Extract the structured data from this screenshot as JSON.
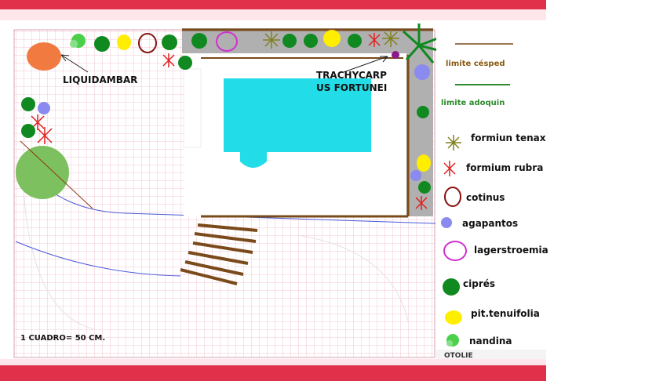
{
  "labels": {
    "liquidambar": "LIQUIDAMBAR",
    "trachycarpus_line1": "TRACHYCARP",
    "trachycarpus_line2": "US FORTUNEI",
    "scale": "1 CUADRO= 50 CM.",
    "bottom_fragment": "OTOLIE"
  },
  "legend": [
    {
      "key": "limite-cesped",
      "label": "limite césped",
      "color": "#7a4a1a"
    },
    {
      "key": "limite-adoquin",
      "label": "limite adoquin",
      "color": "#2d8a2d"
    },
    {
      "key": "formiun-tenax",
      "label": "formiun tenax",
      "icon": "star-asterisk-icon",
      "color": "#808020"
    },
    {
      "key": "formium-rubra",
      "label": "formium rubra",
      "icon": "red-asterisk-icon",
      "color": "#e02020"
    },
    {
      "key": "cotinus",
      "label": "cotinus",
      "icon": "ring-icon",
      "color": "#8a1010"
    },
    {
      "key": "agapantos",
      "label": "agapantos",
      "icon": "blue-flower-icon",
      "color": "#8a8af0"
    },
    {
      "key": "lagerstroemia",
      "label": "lagerstroemia",
      "icon": "magenta-ring-icon",
      "color": "#d030d0"
    },
    {
      "key": "cipres",
      "label": "ciprés",
      "icon": "green-circle-icon",
      "color": "#108a20"
    },
    {
      "key": "pit-tenuifolia",
      "label": "pit.tenuifolia",
      "icon": "yellow-circle-icon",
      "color": "#ffee00"
    },
    {
      "key": "nandina",
      "label": "nandina",
      "icon": "green-flower-icon",
      "color": "#4cd04c"
    }
  ],
  "colors": {
    "grid_line": "#f0b8c8",
    "frame": "#e0304a",
    "pool": "#22dde8",
    "deck": "#b0b0b0",
    "edge": "#7a4a1a",
    "liquidambar": "#f07a40",
    "big_tree": "#7cc060"
  }
}
